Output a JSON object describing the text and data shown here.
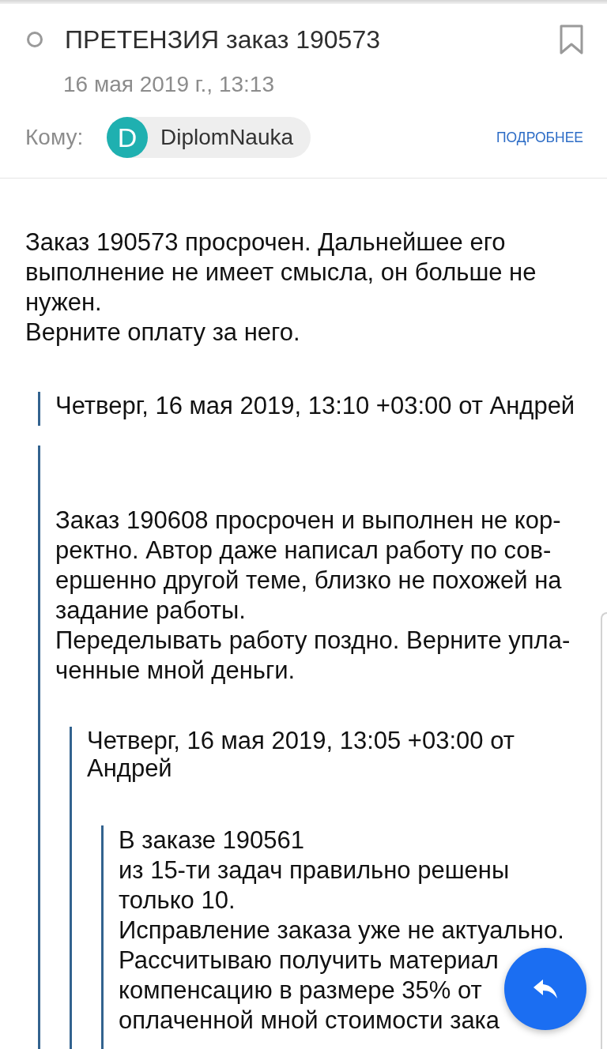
{
  "header": {
    "subject": "ПРЕТЕНЗИЯ заказ 190573",
    "bookmarked": false,
    "date": "16 мая 2019 г., 13:13",
    "recipient_label": "Кому:",
    "recipient": {
      "initial": "D",
      "name": "DiplomNauka"
    },
    "details_link": "ПОДРОБНЕЕ"
  },
  "message": {
    "paragraphs": [
      "Заказ 190573 просрочен. Дальнейшее его\nвыполнение не имеет смысла, он больше не\nнужен.",
      "Верните оплату за него."
    ],
    "quote": {
      "header": "Четверг, 16 мая 2019, 13:10 +03:00 от Андрей",
      "paragraphs": [
        "Заказ 190608 просрочен и выполнен не кор-\nректно. Автор даже написал работу по сов-\nершенно другой теме, близко не похожей на\nзадание работы.",
        "Переделывать работу поздно. Верните упла-\nченные мной деньги."
      ],
      "quote": {
        "header": "Четверг, 16 мая 2019, 13:05 +03:00 от\nАндрей",
        "quote": {
          "paragraphs": [
            "В заказе 190561\nиз 15-ти задач правильно решены\nтолько 10.",
            "Исправление заказа уже не актуально.",
            "Рассчитываю получить материал\nкомпенсацию в размере 35% от\nоплаченной мной стоимости зака"
          ]
        }
      }
    }
  }
}
